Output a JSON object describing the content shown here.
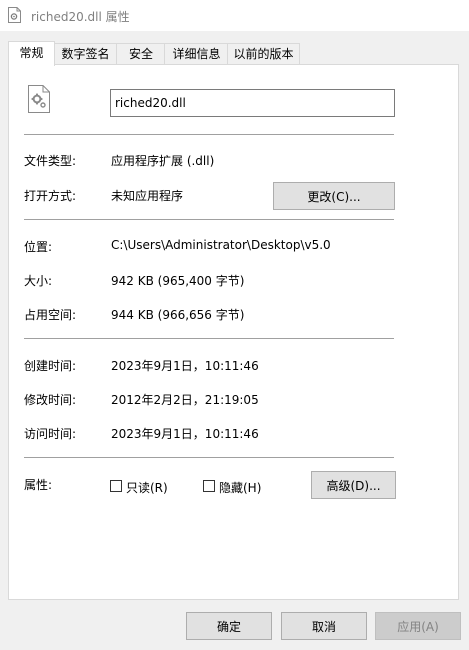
{
  "window": {
    "title": "riched20.dll 属性"
  },
  "tabs": [
    "常规",
    "数字签名",
    "安全",
    "详细信息",
    "以前的版本"
  ],
  "general": {
    "file_name": "riched20.dll",
    "file_type_label": "文件类型:",
    "file_type_value": "应用程序扩展 (.dll)",
    "opens_with_label": "打开方式:",
    "opens_with_value": "未知应用程序",
    "change_button": "更改(C)...",
    "location_label": "位置:",
    "location_value": "C:\\Users\\Administrator\\Desktop\\v5.0",
    "size_label": "大小:",
    "size_value": "942 KB (965,400 字节)",
    "size_on_disk_label": "占用空间:",
    "size_on_disk_value": "944 KB (966,656 字节)",
    "created_label": "创建时间:",
    "created_value": "2023年9月1日，10:11:46",
    "modified_label": "修改时间:",
    "modified_value": "2012年2月2日，21:19:05",
    "accessed_label": "访问时间:",
    "accessed_value": "2023年9月1日，10:11:46",
    "attributes_label": "属性:",
    "readonly_label": "只读(R)",
    "hidden_label": "隐藏(H)",
    "advanced_button": "高级(D)..."
  },
  "footer": {
    "ok": "确定",
    "cancel": "取消",
    "apply": "应用(A)"
  },
  "icons": {
    "title": "gear-file-icon",
    "file": "gear-file-icon"
  },
  "colors": {
    "panel_bg": "#ffffff",
    "window_bg": "#f0f0f0",
    "button_bg": "#e1e1e1",
    "disabled_text": "#838383"
  }
}
